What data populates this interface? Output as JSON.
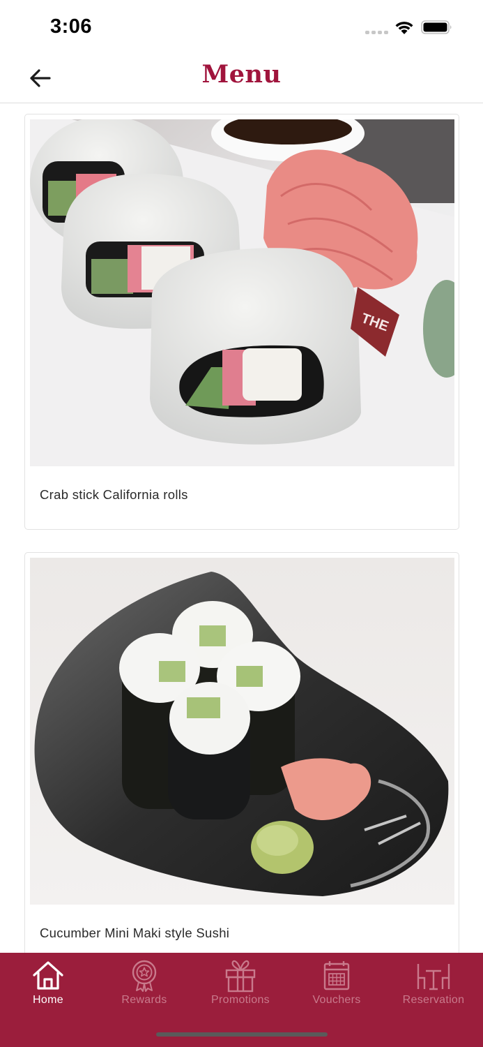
{
  "status_bar": {
    "time": "3:06",
    "icons": [
      "cellular-signal-icon",
      "wifi-icon",
      "battery-icon"
    ]
  },
  "header": {
    "title": "Menu",
    "back_icon": "arrow-left-icon"
  },
  "menu_items": [
    {
      "name": "Crab stick California rolls",
      "image": "california-roll-photo"
    },
    {
      "name": "Cucumber Mini Maki style Sushi",
      "image": "cucumber-maki-photo"
    }
  ],
  "bottom_nav": {
    "items": [
      {
        "label": "Home",
        "icon": "home-icon",
        "active": true
      },
      {
        "label": "Rewards",
        "icon": "rewards-medal-icon",
        "active": false
      },
      {
        "label": "Promotions",
        "icon": "gift-icon",
        "active": false
      },
      {
        "label": "Vouchers",
        "icon": "calendar-voucher-icon",
        "active": false
      },
      {
        "label": "Reservation",
        "icon": "table-reservation-icon",
        "active": false
      }
    ]
  },
  "colors": {
    "brand": "#9b1e3c",
    "title": "#a0143c",
    "nav_inactive": "#c97a8c",
    "nav_active": "#ffffff"
  }
}
